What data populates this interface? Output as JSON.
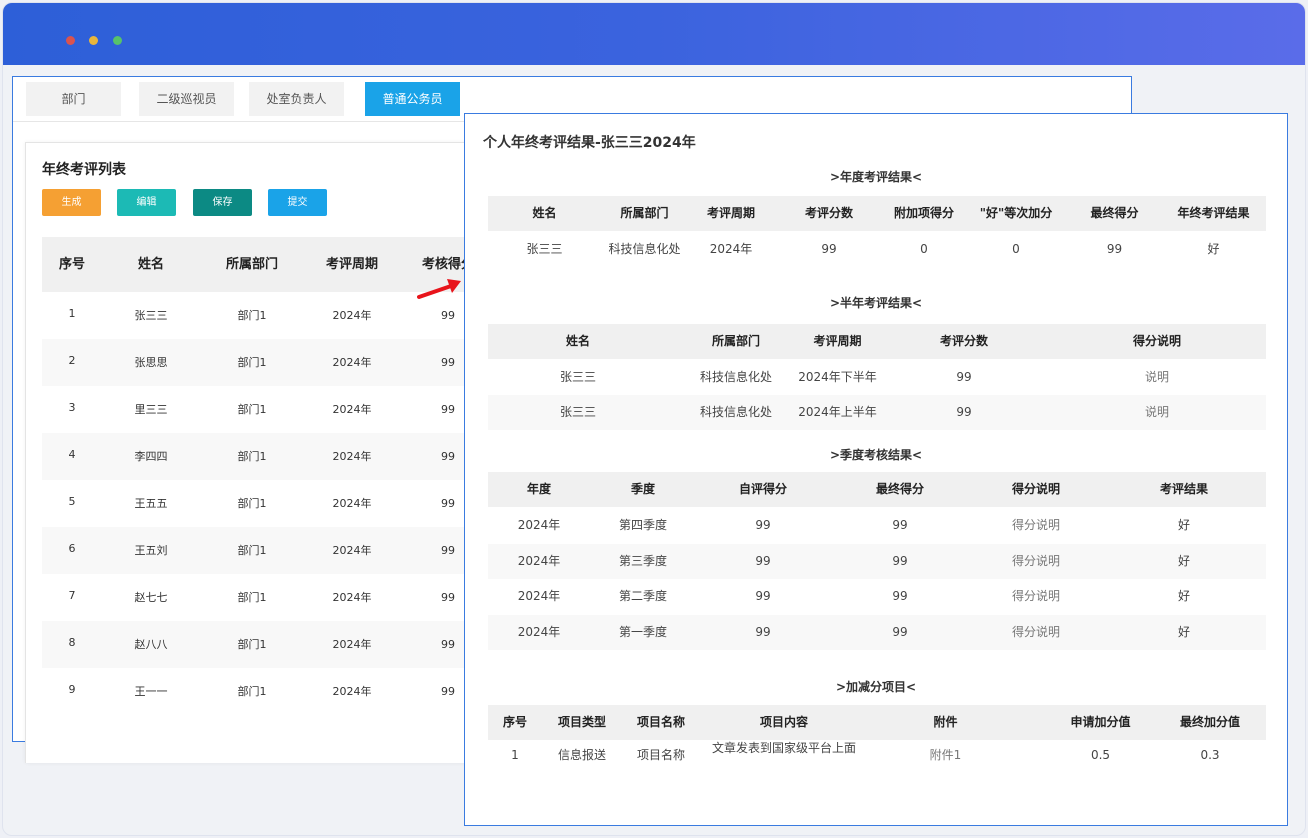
{
  "tabs": [
    "部门",
    "二级巡视员",
    "处室负责人",
    "普通公务员"
  ],
  "list": {
    "title": "年终考评列表",
    "buttons": [
      {
        "label": "生成",
        "color": "#f5a033"
      },
      {
        "label": "编辑",
        "color": "#1cbab5"
      },
      {
        "label": "保存",
        "color": "#0c8a84"
      },
      {
        "label": "提交",
        "color": "#1aa3e8"
      }
    ],
    "headers": [
      "序号",
      "姓名",
      "所属部门",
      "考评周期",
      "考核得分"
    ],
    "rows": [
      [
        "1",
        "张三三",
        "部门1",
        "2024年",
        "99"
      ],
      [
        "2",
        "张思思",
        "部门1",
        "2024年",
        "99"
      ],
      [
        "3",
        "里三三",
        "部门1",
        "2024年",
        "99"
      ],
      [
        "4",
        "李四四",
        "部门1",
        "2024年",
        "99"
      ],
      [
        "5",
        "王五五",
        "部门1",
        "2024年",
        "99"
      ],
      [
        "6",
        "王五刘",
        "部门1",
        "2024年",
        "99"
      ],
      [
        "7",
        "赵七七",
        "部门1",
        "2024年",
        "99"
      ],
      [
        "8",
        "赵八八",
        "部门1",
        "2024年",
        "99"
      ],
      [
        "9",
        "王一一",
        "部门1",
        "2024年",
        "99"
      ]
    ]
  },
  "popup": {
    "title": "个人年终考评结果-张三三2024年",
    "annual": {
      "title": ">年度考评结果<",
      "headers": [
        "姓名",
        "所属部门",
        "考评周期",
        "考评分数",
        "附加项得分",
        "\"好\"等次加分",
        "最终得分",
        "年终考评结果"
      ],
      "rows": [
        [
          "张三三",
          "科技信息化处",
          "2024年",
          "99",
          "0",
          "0",
          "99",
          "好"
        ]
      ]
    },
    "half": {
      "title": ">半年考评结果<",
      "headers": [
        "姓名",
        "所属部门",
        "考评周期",
        "考评分数",
        "得分说明"
      ],
      "rows": [
        [
          "张三三",
          "科技信息化处",
          "2024年下半年",
          "99",
          "说明"
        ],
        [
          "张三三",
          "科技信息化处",
          "2024年上半年",
          "99",
          "说明"
        ]
      ]
    },
    "quarter": {
      "title": ">季度考核结果<",
      "headers": [
        "年度",
        "季度",
        "自评得分",
        "最终得分",
        "得分说明",
        "考评结果"
      ],
      "rows": [
        [
          "2024年",
          "第四季度",
          "99",
          "99",
          "得分说明",
          "好"
        ],
        [
          "2024年",
          "第三季度",
          "99",
          "99",
          "得分说明",
          "好"
        ],
        [
          "2024年",
          "第二季度",
          "99",
          "99",
          "得分说明",
          "好"
        ],
        [
          "2024年",
          "第一季度",
          "99",
          "99",
          "得分说明",
          "好"
        ]
      ]
    },
    "bonus": {
      "title": ">加减分项目<",
      "headers": [
        "序号",
        "项目类型",
        "项目名称",
        "项目内容",
        "附件",
        "申请加分值",
        "最终加分值"
      ],
      "rows": [
        [
          "1",
          "信息报送",
          "项目名称",
          "文章发表到国家级平台上面",
          "附件1",
          "0.5",
          "0.3"
        ]
      ]
    }
  },
  "colors": {
    "accent": "#1aa3e8",
    "titlebar": "#3b63de",
    "panel_border": "#3a7be0",
    "arrow": "#e8141b"
  }
}
